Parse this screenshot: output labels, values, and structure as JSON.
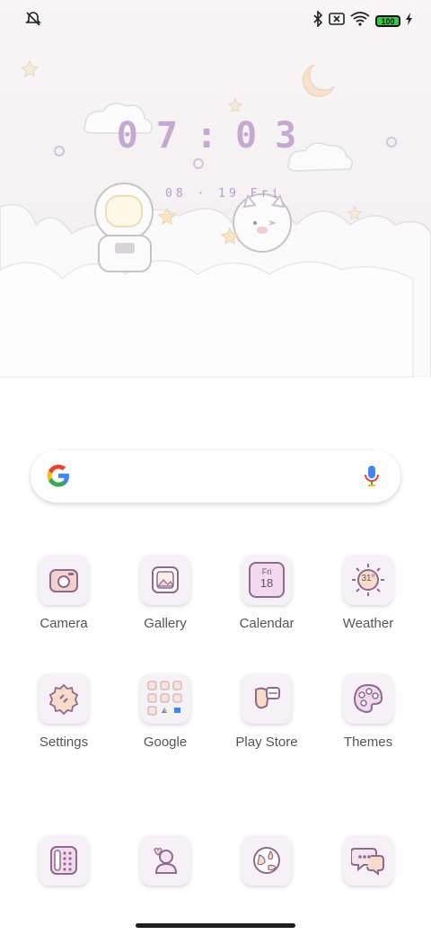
{
  "status_bar": {
    "battery": "100",
    "left_icons": [
      "alarm-off-icon"
    ],
    "right_icons": [
      "bluetooth-icon",
      "sim-off-icon",
      "wifi-icon",
      "battery-icon",
      "charging-icon"
    ]
  },
  "wallpaper": {
    "clock": "07:03",
    "date": "08 · 19 Fri",
    "accent": "#c5a9d0"
  },
  "search_bar": {
    "icons": [
      "google-logo-icon",
      "microphone-icon"
    ]
  },
  "apps_row1": [
    {
      "label": "Camera",
      "icon": "camera-icon"
    },
    {
      "label": "Gallery",
      "icon": "gallery-icon"
    },
    {
      "label": "Calendar",
      "icon": "calendar-icon",
      "day": "Fri",
      "date": "18"
    },
    {
      "label": "Weather",
      "icon": "weather-icon",
      "temp": "31°"
    }
  ],
  "apps_row2": [
    {
      "label": "Settings",
      "icon": "settings-icon"
    },
    {
      "label": "Google",
      "icon": "google-folder-icon"
    },
    {
      "label": "Play Store",
      "icon": "play-store-icon"
    },
    {
      "label": "Themes",
      "icon": "themes-icon"
    }
  ],
  "dock": [
    {
      "icon": "phone-dialer-icon"
    },
    {
      "icon": "contacts-icon"
    },
    {
      "icon": "browser-icon"
    },
    {
      "icon": "messages-icon"
    }
  ]
}
